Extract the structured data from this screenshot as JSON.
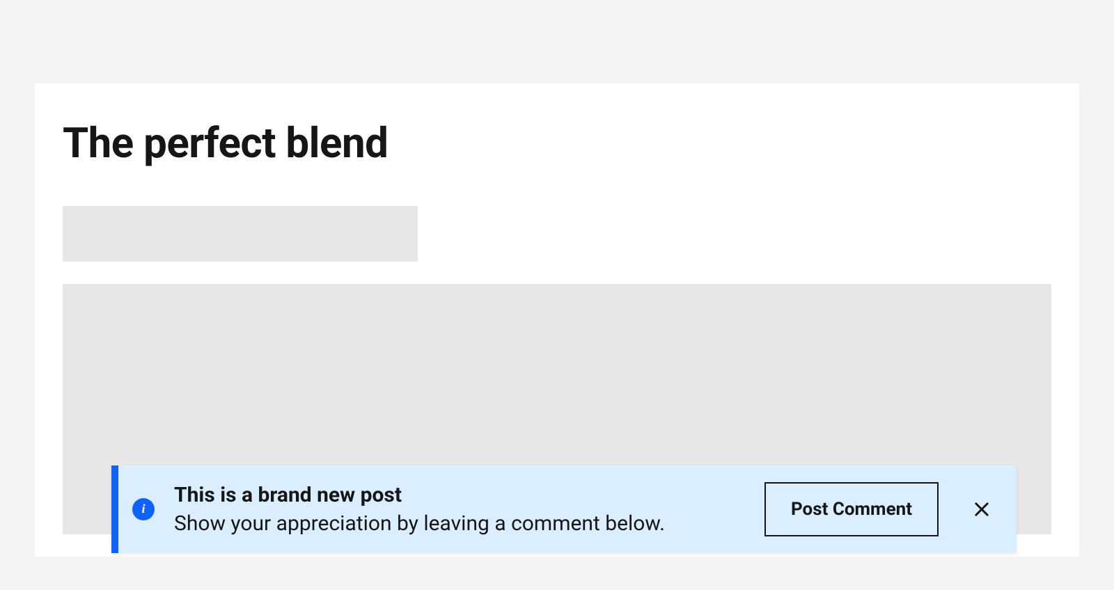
{
  "article": {
    "title": "The perfect blend"
  },
  "notification": {
    "title": "This is a brand new post",
    "body": "Show your appreciation by leaving a comment below.",
    "action_label": "Post Comment"
  }
}
